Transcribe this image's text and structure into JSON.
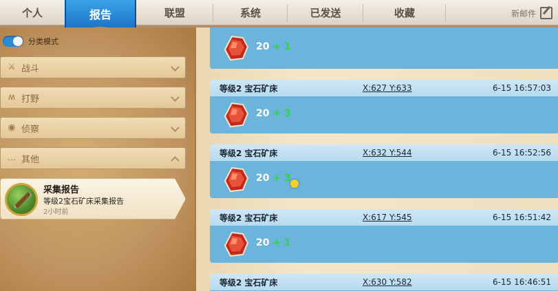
{
  "tabs": {
    "personal": "个人",
    "report": "报告",
    "alliance": "联盟",
    "system": "系统",
    "sent": "已发送",
    "favorites": "收藏",
    "new_mail": "新邮件"
  },
  "sidebar": {
    "toggle_label": "分类模式",
    "filters": [
      {
        "label": "战斗",
        "icon": "crossed-swords-icon"
      },
      {
        "label": "打野",
        "icon": "claw-icon"
      },
      {
        "label": "侦察",
        "icon": "eye-icon"
      },
      {
        "label": "其他",
        "icon": "more-icon"
      }
    ],
    "report": {
      "title": "采集报告",
      "desc": "等级2宝石矿床采集报告",
      "time": "2小时前"
    }
  },
  "entries": [
    {
      "name": "",
      "coords": "",
      "date": "",
      "amount": "20",
      "bonus": "+ 1"
    },
    {
      "name": "等级2 宝石矿床",
      "coords": "X:627 Y:633",
      "date": "6-15 16:57:03",
      "amount": "20",
      "bonus": "+ 3"
    },
    {
      "name": "等级2 宝石矿床",
      "coords": "X:632 Y:544",
      "date": "6-15 16:52:56",
      "amount": "20",
      "bonus": "+ 3"
    },
    {
      "name": "等级2 宝石矿床",
      "coords": "X:617 Y:545",
      "date": "6-15 16:51:42",
      "amount": "20",
      "bonus": "+ 1"
    },
    {
      "name": "等级2 宝石矿床",
      "coords": "X:630 Y:582",
      "date": "6-15 16:46:51",
      "amount": "",
      "bonus": ""
    }
  ],
  "colors": {
    "active_tab": "#2a8bd8",
    "entry_body": "#6cb4dc",
    "entry_head": "#c4e1f2",
    "bonus_green": "#2ed44a"
  }
}
